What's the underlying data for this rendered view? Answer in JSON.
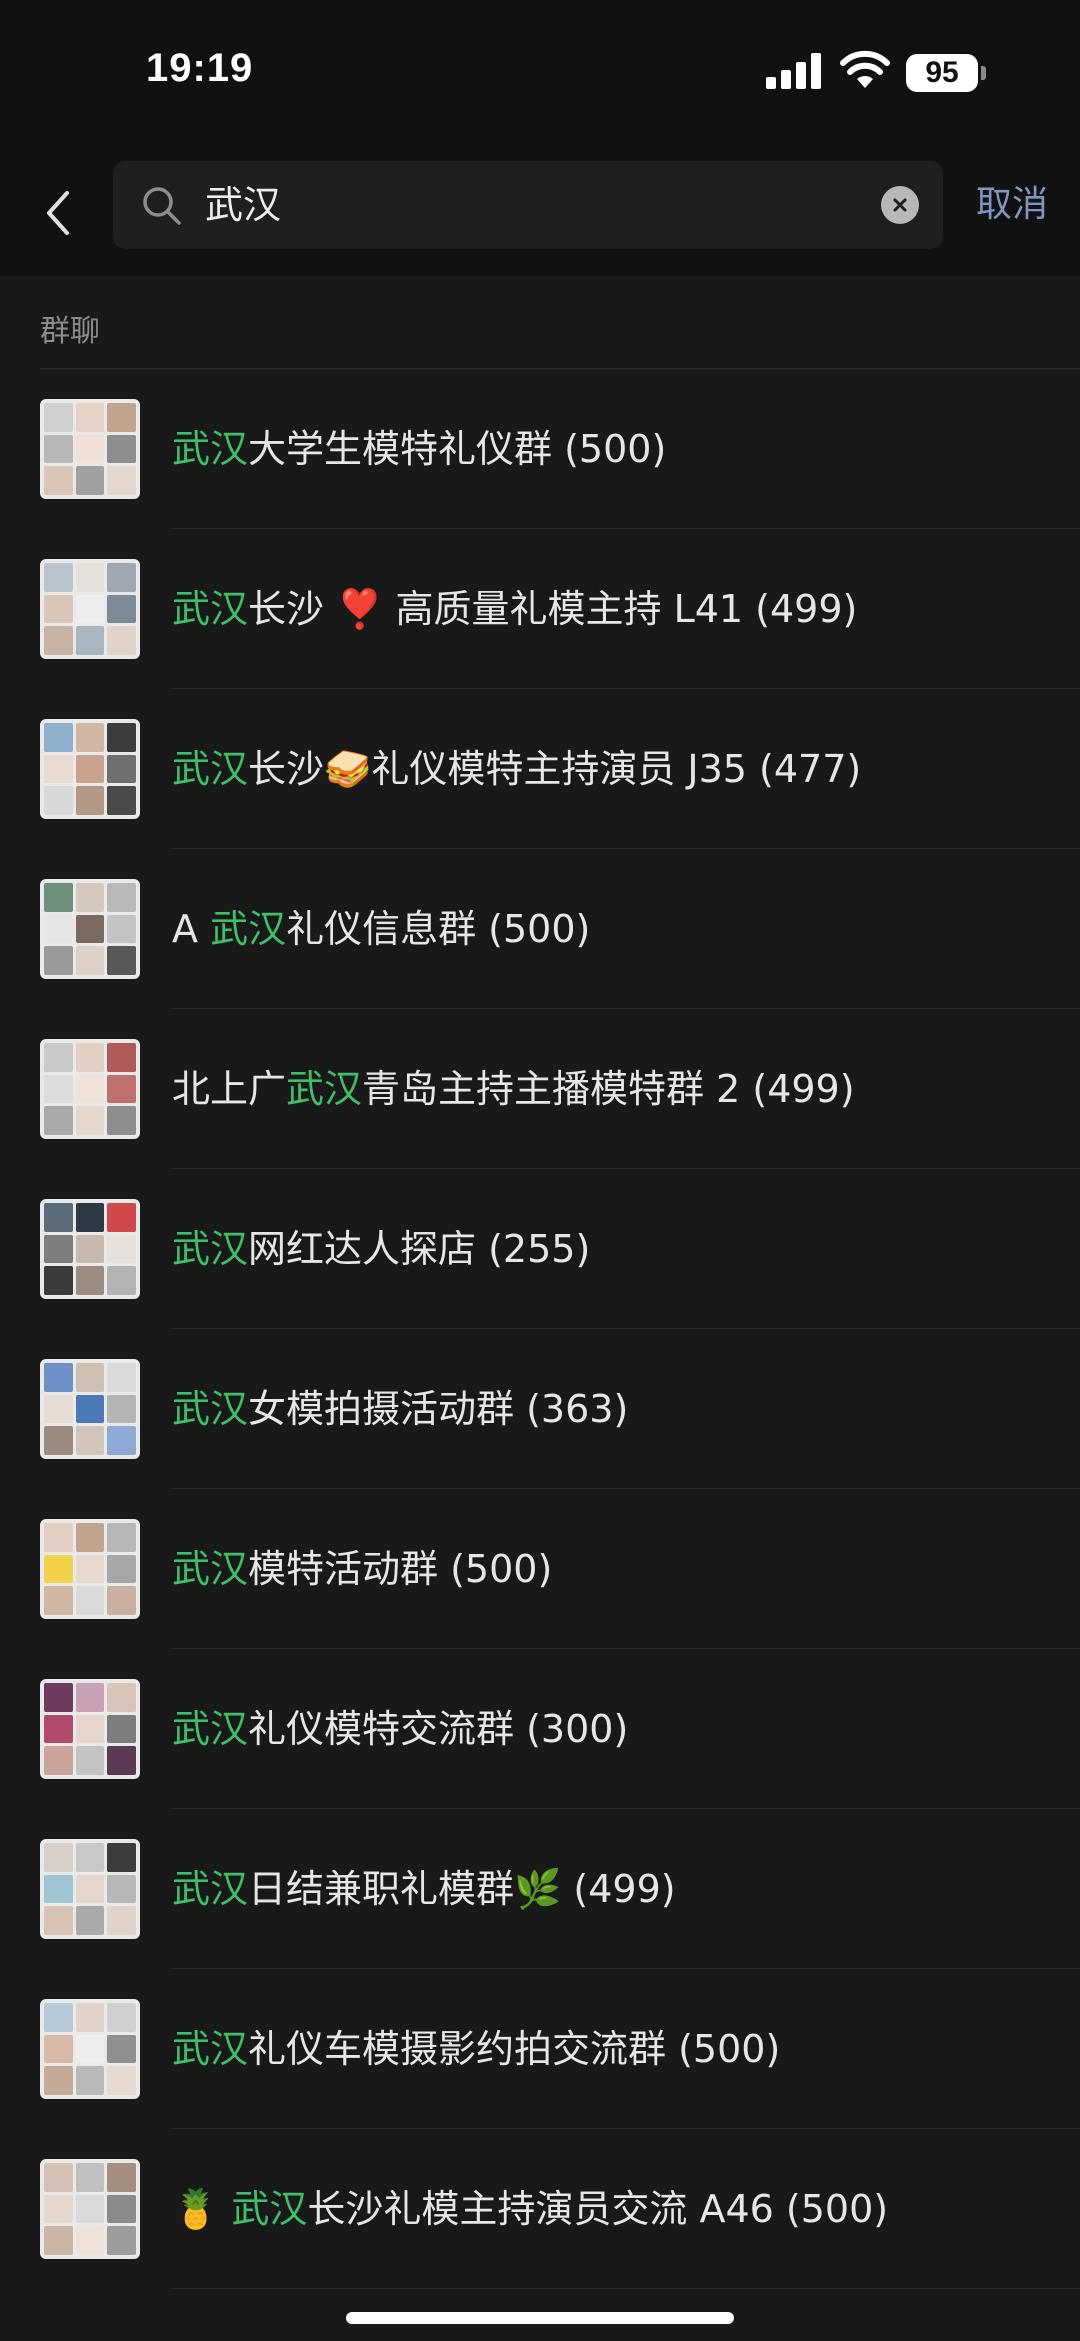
{
  "status": {
    "time": "19:19",
    "battery": "95"
  },
  "search": {
    "query": "武汉",
    "cancel_label": "取消"
  },
  "section": {
    "title": "群聊"
  },
  "results": [
    {
      "pre": "",
      "highlight": "武汉",
      "post": "大学生模特礼仪群 (500)"
    },
    {
      "pre": "",
      "highlight": "武汉",
      "post": "长沙 ❣️ 高质量礼模主持 L41 (499)"
    },
    {
      "pre": "",
      "highlight": "武汉",
      "post": "长沙🥪礼仪模特主持演员 J35 (477)"
    },
    {
      "pre": "A ",
      "highlight": "武汉",
      "post": "礼仪信息群 (500)"
    },
    {
      "pre": "北上广",
      "highlight": "武汉",
      "post": "青岛主持主播模特群 2 (499)"
    },
    {
      "pre": "",
      "highlight": "武汉",
      "post": "网红达人探店 (255)"
    },
    {
      "pre": "",
      "highlight": "武汉",
      "post": "女模拍摄活动群 (363)"
    },
    {
      "pre": "",
      "highlight": "武汉",
      "post": "模特活动群 (500)"
    },
    {
      "pre": "",
      "highlight": "武汉",
      "post": "礼仪模特交流群 (300)"
    },
    {
      "pre": "",
      "highlight": "武汉",
      "post": "日结兼职礼模群🌿 (499)"
    },
    {
      "pre": "",
      "highlight": "武汉",
      "post": "礼仪车模摄影约拍交流群 (500)"
    },
    {
      "pre": "🍍 ",
      "highlight": "武汉",
      "post": "长沙礼模主持演员交流 A46 (500)"
    }
  ],
  "colors": {
    "highlight": "#3fbf68",
    "cancel": "#7e95bf",
    "background": "#191919"
  }
}
